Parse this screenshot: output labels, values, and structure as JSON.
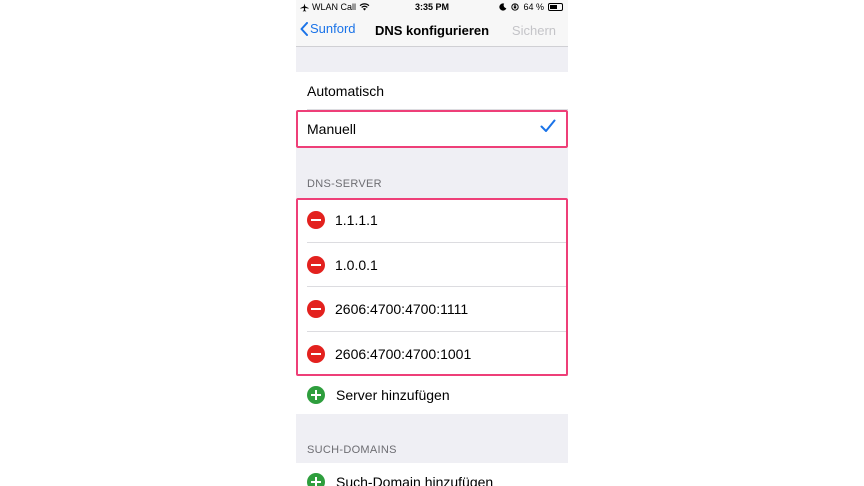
{
  "status_bar": {
    "carrier": "WLAN Call",
    "time": "3:35 PM",
    "battery": "64 %"
  },
  "nav": {
    "back_label": "Sunford",
    "title": "DNS konfigurieren",
    "save_label": "Sichern"
  },
  "mode": {
    "automatic_label": "Automatisch",
    "manual_label": "Manuell",
    "selected": "Manuell"
  },
  "dns_servers": {
    "header": "DNS-SERVER",
    "items": [
      {
        "address": "1.1.1.1"
      },
      {
        "address": "1.0.0.1"
      },
      {
        "address": "2606:4700:4700:1111"
      },
      {
        "address": "2606:4700:4700:1001"
      }
    ],
    "add_label": "Server hinzufügen"
  },
  "search_domains": {
    "header": "SUCH-DOMAINS",
    "add_label": "Such-Domain hinzufügen"
  },
  "colors": {
    "accent": "#1a73e8",
    "delete": "#e3211e",
    "add": "#2e9e3d",
    "highlight": "#ee3f78"
  },
  "icons": [
    "airplane-icon",
    "wifi-icon",
    "moon-icon",
    "orientation-lock-icon",
    "battery-icon",
    "chevron-left-icon",
    "checkmark-icon",
    "minus-circle-icon",
    "plus-circle-icon"
  ]
}
